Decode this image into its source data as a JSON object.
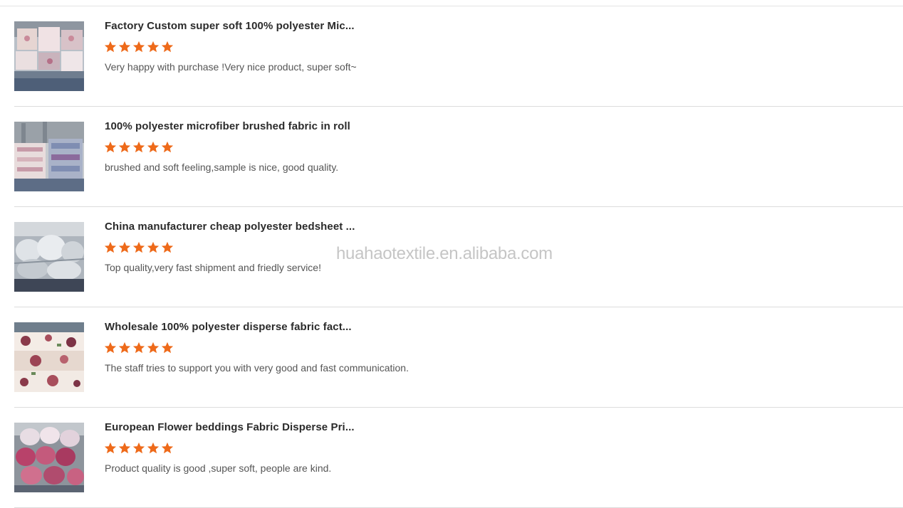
{
  "colors": {
    "star": "#ee6a1a",
    "title": "#2b2b2b",
    "comment": "#555555",
    "divider": "#dcdcdc"
  },
  "reviews": [
    {
      "title": "Factory Custom super soft 100% polyester Mic...",
      "rating": 5,
      "comment": "Very happy with purchase !Very nice product, super soft~",
      "thumb_icon": "fabric-rolls-photo"
    },
    {
      "title": "100% polyester microfiber brushed fabric in roll",
      "rating": 5,
      "comment": "brushed and soft feeling,sample is nice, good quality.",
      "thumb_icon": "warehouse-fabric-photo"
    },
    {
      "title": "China manufacturer cheap polyester bedsheet ...",
      "rating": 5,
      "comment": "Top quality,very fast shipment and friedly service!",
      "thumb_icon": "wrapped-rolls-photo"
    },
    {
      "title": "Wholesale 100% polyester disperse fabric fact...",
      "rating": 5,
      "comment": "The staff tries to support you with very good and fast communication.",
      "thumb_icon": "floral-fabric-photo"
    },
    {
      "title": "European Flower beddings Fabric Disperse Pri...",
      "rating": 5,
      "comment": "Product quality is good ,super soft, people are kind.",
      "thumb_icon": "pink-rolls-photo"
    }
  ],
  "watermark": "huahaotextile.en.alibaba.com"
}
